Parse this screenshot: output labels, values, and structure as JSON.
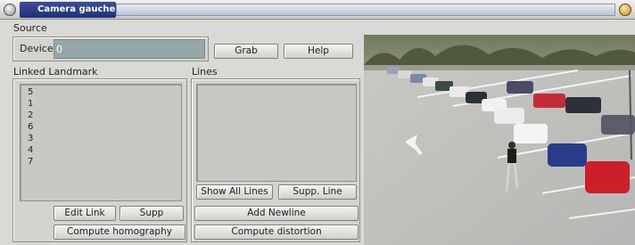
{
  "window": {
    "title": "Camera gauche"
  },
  "source": {
    "label": "Source",
    "device_label": "Device",
    "device_value": "0",
    "grab_label": "Grab",
    "help_label": "Help"
  },
  "linked_landmark": {
    "label": "Linked Landmark",
    "items": [
      "5",
      "1",
      "2",
      "6",
      "3",
      "4",
      "7"
    ],
    "edit_link_label": "Edit Link",
    "supp_label": "Supp",
    "compute_homography_label": "Compute homography"
  },
  "lines": {
    "label": "Lines",
    "items": [],
    "show_all_lines_label": "Show All Lines",
    "supp_line_label": "Supp. Line",
    "add_newline_label": "Add Newline",
    "compute_distortion_label": "Compute distortion"
  },
  "camera_view": {
    "description_icon": "parking-lot-camera-image"
  },
  "colors": {
    "title_accent": "#1f2f78",
    "window_bg": "#d9d9d6",
    "device_field_bg": "#95a8a7"
  }
}
